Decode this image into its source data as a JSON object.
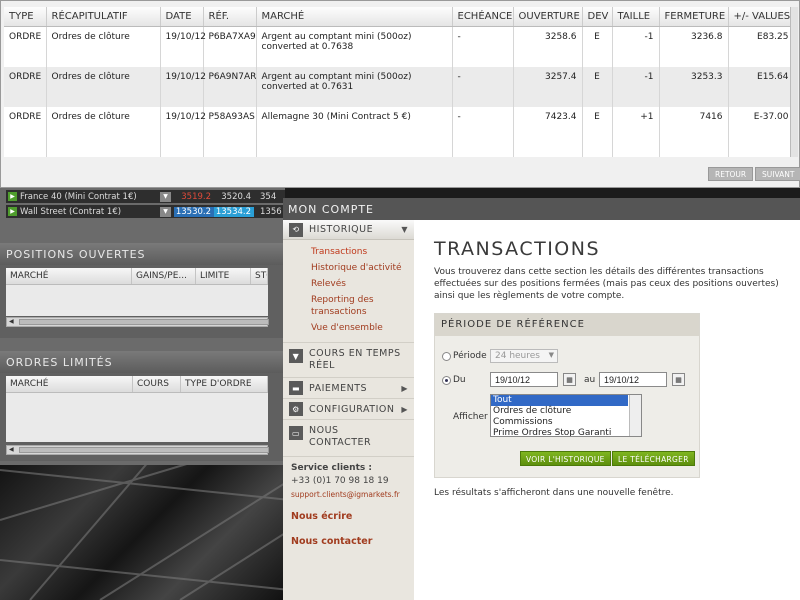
{
  "table": {
    "headers": [
      "TYPE",
      "RÉCAPITULATIF",
      "DATE",
      "RÉF.",
      "MARCHÉ",
      "ECHÉANCE",
      "OUVERTURE",
      "DEV",
      "TAILLE",
      "FERMETURE",
      "+/- VALUES"
    ],
    "rows": [
      {
        "type": "ORDRE",
        "recap": "Ordres de clôture",
        "date": "19/10/12",
        "ref": "P6BA7XA9",
        "market": "Argent au comptant mini (500oz) converted at 0.7638",
        "echeance": "-",
        "open": "3258.6",
        "dev": "E",
        "size": "-1",
        "close": "3236.8",
        "pnl": "E83.25"
      },
      {
        "type": "ORDRE",
        "recap": "Ordres de clôture",
        "date": "19/10/12",
        "ref": "P6A9N7AR",
        "market": "Argent au comptant mini (500oz) converted at 0.7631",
        "echeance": "-",
        "open": "3257.4",
        "dev": "E",
        "size": "-1",
        "close": "3253.3",
        "pnl": "E15.64"
      },
      {
        "type": "ORDRE",
        "recap": "Ordres de clôture",
        "date": "19/10/12",
        "ref": "P58A93AS",
        "market": "Allemagne 30 (Mini Contract 5 €)",
        "echeance": "-",
        "open": "7423.4",
        "dev": "E",
        "size": "+1",
        "close": "7416",
        "pnl": "E-37.00"
      }
    ],
    "pager": {
      "back": "RETOUR",
      "next": "SUIVANT"
    }
  },
  "markets": [
    {
      "name": "France 40 (Mini Contrat 1€)",
      "sell": "3519.2",
      "buy": "3520.4",
      "chg": "354"
    },
    {
      "name": "Wall Street (Contrat 1€)",
      "sell": "13530.2",
      "buy": "13534.2",
      "chg": "1356"
    }
  ],
  "positions": {
    "title": "POSITIONS OUVERTES",
    "cols": [
      "MARCHÉ",
      "GAINS/PE...",
      "LIMITE",
      "STO"
    ]
  },
  "orders": {
    "title": "ORDRES LIMITÉS",
    "cols": [
      "MARCHÉ",
      "COURS",
      "TYPE D'ORDRE"
    ]
  },
  "account": {
    "title": "MON COMPTE",
    "nav": {
      "historique": "HISTORIQUE",
      "sub": [
        "Transactions",
        "Historique d'activité",
        "Relevés",
        "Reporting des transactions",
        "Vue d'ensemble"
      ],
      "cours": "COURS EN TEMPS RÉEL",
      "paiements": "PAIEMENTS",
      "configuration": "CONFIGURATION",
      "contact": "NOUS CONTACTER"
    },
    "support": {
      "label": "Service clients :",
      "phone": "+33 (0)1 70 98 18 19",
      "email": "support.clients@igmarkets.fr",
      "write": "Nous écrire",
      "contact": "Nous contacter"
    },
    "page_title": "TRANSACTIONS",
    "intro": "Vous trouverez dans cette section les détails des différentes transactions effectuées sur des positions fermées (mais pas ceux des positions ouvertes) ainsi que les règlements de votre compte.",
    "period": {
      "title": "PÉRIODE DE RÉFÉRENCE",
      "period_label": "Période",
      "period_value": "24 heures",
      "from_label": "Du",
      "from": "19/10/12",
      "to_label": "au",
      "to": "19/10/12",
      "show_label": "Afficher",
      "options": [
        "Tout",
        "Ordres de clôture",
        "Commissions",
        "Prime Ordres Stop Garanti"
      ],
      "view_btn": "VOIR L'HISTORIQUE",
      "download_btn": "LE TÉLÉCHARGER"
    },
    "result_note": "Les résultats s'afficheront dans une nouvelle fenêtre."
  }
}
